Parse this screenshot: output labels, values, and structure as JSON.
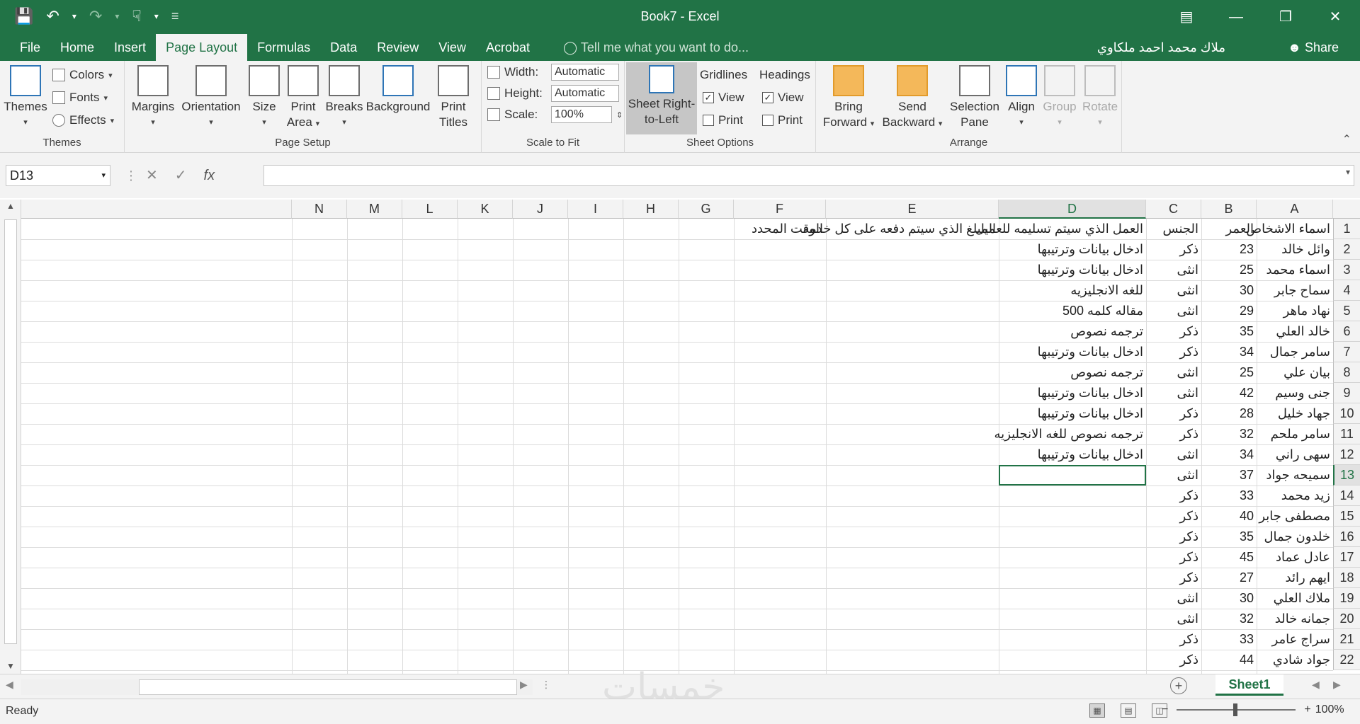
{
  "window": {
    "title": "Book7 - Excel"
  },
  "menu": {
    "tabs": [
      "File",
      "Home",
      "Insert",
      "Page Layout",
      "Formulas",
      "Data",
      "Review",
      "View",
      "Acrobat"
    ],
    "active_tab": "Page Layout",
    "tell_me": "Tell me what you want to do...",
    "user": "ملاك محمد احمد ملكاوي",
    "share": "Share"
  },
  "ribbon": {
    "themes": {
      "themes": "Themes",
      "colors": "Colors",
      "fonts": "Fonts",
      "effects": "Effects",
      "label": "Themes"
    },
    "page_setup": {
      "margins": "Margins",
      "orientation": "Orientation",
      "size": "Size",
      "print_area_1": "Print",
      "print_area_2": "Area",
      "breaks": "Breaks",
      "background": "Background",
      "print_titles_1": "Print",
      "print_titles_2": "Titles",
      "label": "Page Setup"
    },
    "scale_to_fit": {
      "width_label": "Width:",
      "width_value": "Automatic",
      "height_label": "Height:",
      "height_value": "Automatic",
      "scale_label": "Scale:",
      "scale_value": "100%",
      "label": "Scale to Fit"
    },
    "sheet_options": {
      "sheet_rtl_1": "Sheet Right-",
      "sheet_rtl_2": "to-Left",
      "gridlines": "Gridlines",
      "headings": "Headings",
      "view": "View",
      "print": "Print",
      "label": "Sheet Options"
    },
    "arrange": {
      "bring_1": "Bring",
      "bring_2": "Forward",
      "send_1": "Send",
      "send_2": "Backward",
      "selection_1": "Selection",
      "selection_2": "Pane",
      "align": "Align",
      "group": "Group",
      "rotate": "Rotate",
      "label": "Arrange"
    }
  },
  "formula_bar": {
    "name_box": "D13",
    "fx": "fx",
    "value": ""
  },
  "columns": [
    "A",
    "B",
    "C",
    "D",
    "E",
    "F",
    "G",
    "H",
    "I",
    "J",
    "K",
    "L",
    "M",
    "N"
  ],
  "selected_column": "D",
  "selected_row": "13",
  "rows": [
    {
      "n": "1",
      "A": "اسماء الاشخاص",
      "B": "العمر",
      "C": "الجنس",
      "D": "العمل الذي سيتم تسليمه للعميل",
      "E": "المبلغ الذي سيتم دفعه على كل خدمه",
      "F": "الوقت المحدد"
    },
    {
      "n": "2",
      "A": "وائل خالد",
      "B": "23",
      "C": "ذكر",
      "D": "ادخال بيانات وترتيبها",
      "E": "",
      "F": ""
    },
    {
      "n": "3",
      "A": "اسماء محمد",
      "B": "25",
      "C": "انثى",
      "D": "ادخال بيانات وترتيبها",
      "E": "",
      "F": ""
    },
    {
      "n": "4",
      "A": "سماح جابر",
      "B": "30",
      "C": "انثى",
      "D": "للغه الانجليزيه",
      "E": "",
      "F": ""
    },
    {
      "n": "5",
      "A": "نهاد ماهر",
      "B": "29",
      "C": "انثى",
      "D": "مقاله كلمه 500",
      "E": "",
      "F": ""
    },
    {
      "n": "6",
      "A": "خالد العلي",
      "B": "35",
      "C": "ذكر",
      "D": "ترجمه نصوص",
      "E": "",
      "F": ""
    },
    {
      "n": "7",
      "A": "سامر جمال",
      "B": "34",
      "C": "ذكر",
      "D": "ادخال بيانات وترتيبها",
      "E": "",
      "F": ""
    },
    {
      "n": "8",
      "A": "بيان علي",
      "B": "25",
      "C": "انثى",
      "D": "ترجمه نصوص",
      "E": "",
      "F": ""
    },
    {
      "n": "9",
      "A": "جنى وسيم",
      "B": "42",
      "C": "انثى",
      "D": "ادخال بيانات وترتيبها",
      "E": "",
      "F": ""
    },
    {
      "n": "10",
      "A": "جهاد خليل",
      "B": "28",
      "C": "ذكر",
      "D": "ادخال بيانات وترتيبها",
      "E": "",
      "F": ""
    },
    {
      "n": "11",
      "A": "سامر ملحم",
      "B": "32",
      "C": "ذكر",
      "D": "ترجمه نصوص للغه الانجليزيه",
      "E": "",
      "F": ""
    },
    {
      "n": "12",
      "A": "سهى راني",
      "B": "34",
      "C": "انثى",
      "D": "ادخال بيانات وترتيبها",
      "E": "",
      "F": ""
    },
    {
      "n": "13",
      "A": "سميحه جواد",
      "B": "37",
      "C": "انثى",
      "D": "",
      "E": "",
      "F": ""
    },
    {
      "n": "14",
      "A": "زيد محمد",
      "B": "33",
      "C": "ذكر",
      "D": "",
      "E": "",
      "F": ""
    },
    {
      "n": "15",
      "A": "مصطفى جابر",
      "B": "40",
      "C": "ذكر",
      "D": "",
      "E": "",
      "F": ""
    },
    {
      "n": "16",
      "A": "خلدون جمال",
      "B": "35",
      "C": "ذكر",
      "D": "",
      "E": "",
      "F": ""
    },
    {
      "n": "17",
      "A": "عادل عماد",
      "B": "45",
      "C": "ذكر",
      "D": "",
      "E": "",
      "F": ""
    },
    {
      "n": "18",
      "A": "ايهم رائد",
      "B": "27",
      "C": "ذكر",
      "D": "",
      "E": "",
      "F": ""
    },
    {
      "n": "19",
      "A": "ملاك العلي",
      "B": "30",
      "C": "انثى",
      "D": "",
      "E": "",
      "F": ""
    },
    {
      "n": "20",
      "A": "جمانه خالد",
      "B": "32",
      "C": "انثى",
      "D": "",
      "E": "",
      "F": ""
    },
    {
      "n": "21",
      "A": "سراج عامر",
      "B": "33",
      "C": "ذكر",
      "D": "",
      "E": "",
      "F": ""
    },
    {
      "n": "22",
      "A": "جواد شادي",
      "B": "44",
      "C": "ذكر",
      "D": "",
      "E": "",
      "F": ""
    }
  ],
  "sheets": [
    "Sheet1"
  ],
  "watermark": "خمسات",
  "status": {
    "ready": "Ready",
    "zoom": "100%",
    "zoom_out": "−",
    "zoom_in": "+"
  }
}
